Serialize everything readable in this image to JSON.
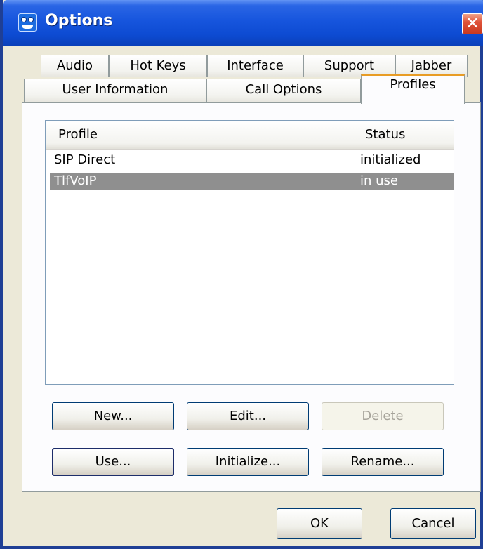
{
  "window": {
    "title": "Options",
    "close_glyph": "✕"
  },
  "tabs": {
    "top_row": [
      "Audio",
      "Hot Keys",
      "Interface",
      "Support",
      "Jabber"
    ],
    "bottom_row": [
      "User Information",
      "Call Options",
      "Profiles"
    ],
    "active": "Profiles"
  },
  "profiles_list": {
    "columns": [
      "Profile",
      "Status"
    ],
    "rows": [
      {
        "profile": "SIP Direct",
        "status": "initialized",
        "selected": false
      },
      {
        "profile": "TlfVoIP",
        "status": "in use",
        "selected": true
      }
    ]
  },
  "buttons": {
    "new": "New...",
    "edit": "Edit...",
    "delete": "Delete",
    "use": "Use...",
    "initialize": "Initialize...",
    "rename": "Rename...",
    "ok": "OK",
    "cancel": "Cancel"
  },
  "colors": {
    "titlebar": "#0d4bd2",
    "selection": "#8f8f8f",
    "active_tab_accent": "#e89c25"
  }
}
